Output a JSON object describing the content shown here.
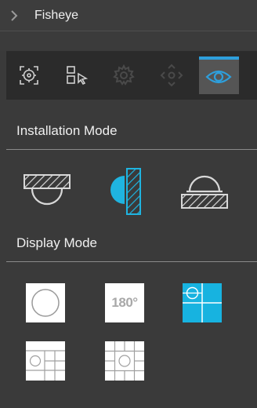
{
  "header": {
    "title": "Fisheye"
  },
  "toolbar": {
    "tools": [
      {
        "name": "focus-target-icon"
      },
      {
        "name": "select-region-icon"
      },
      {
        "name": "settings-gear-icon"
      },
      {
        "name": "ptz-direction-icon"
      },
      {
        "name": "eye-icon",
        "active": true
      }
    ]
  },
  "installation": {
    "title": "Installation Mode",
    "modes": [
      {
        "name": "ceiling-mount-icon"
      },
      {
        "name": "wall-mount-icon",
        "selected": true
      },
      {
        "name": "desktop-mount-icon"
      }
    ]
  },
  "display": {
    "title": "Display Mode",
    "label_180": "180°",
    "modes": [
      {
        "name": "fisheye-original-icon"
      },
      {
        "name": "panorama-180-icon"
      },
      {
        "name": "fisheye-plus-3-icon",
        "selected": true
      },
      {
        "name": "fisheye-plus-4-icon"
      },
      {
        "name": "fisheye-plus-8-icon"
      }
    ]
  },
  "colors": {
    "accent": "#2e9fdc",
    "selected_fill": "#17b3e0",
    "background": "#3a3a3a",
    "toolbar_bg": "#2b2b2b"
  }
}
